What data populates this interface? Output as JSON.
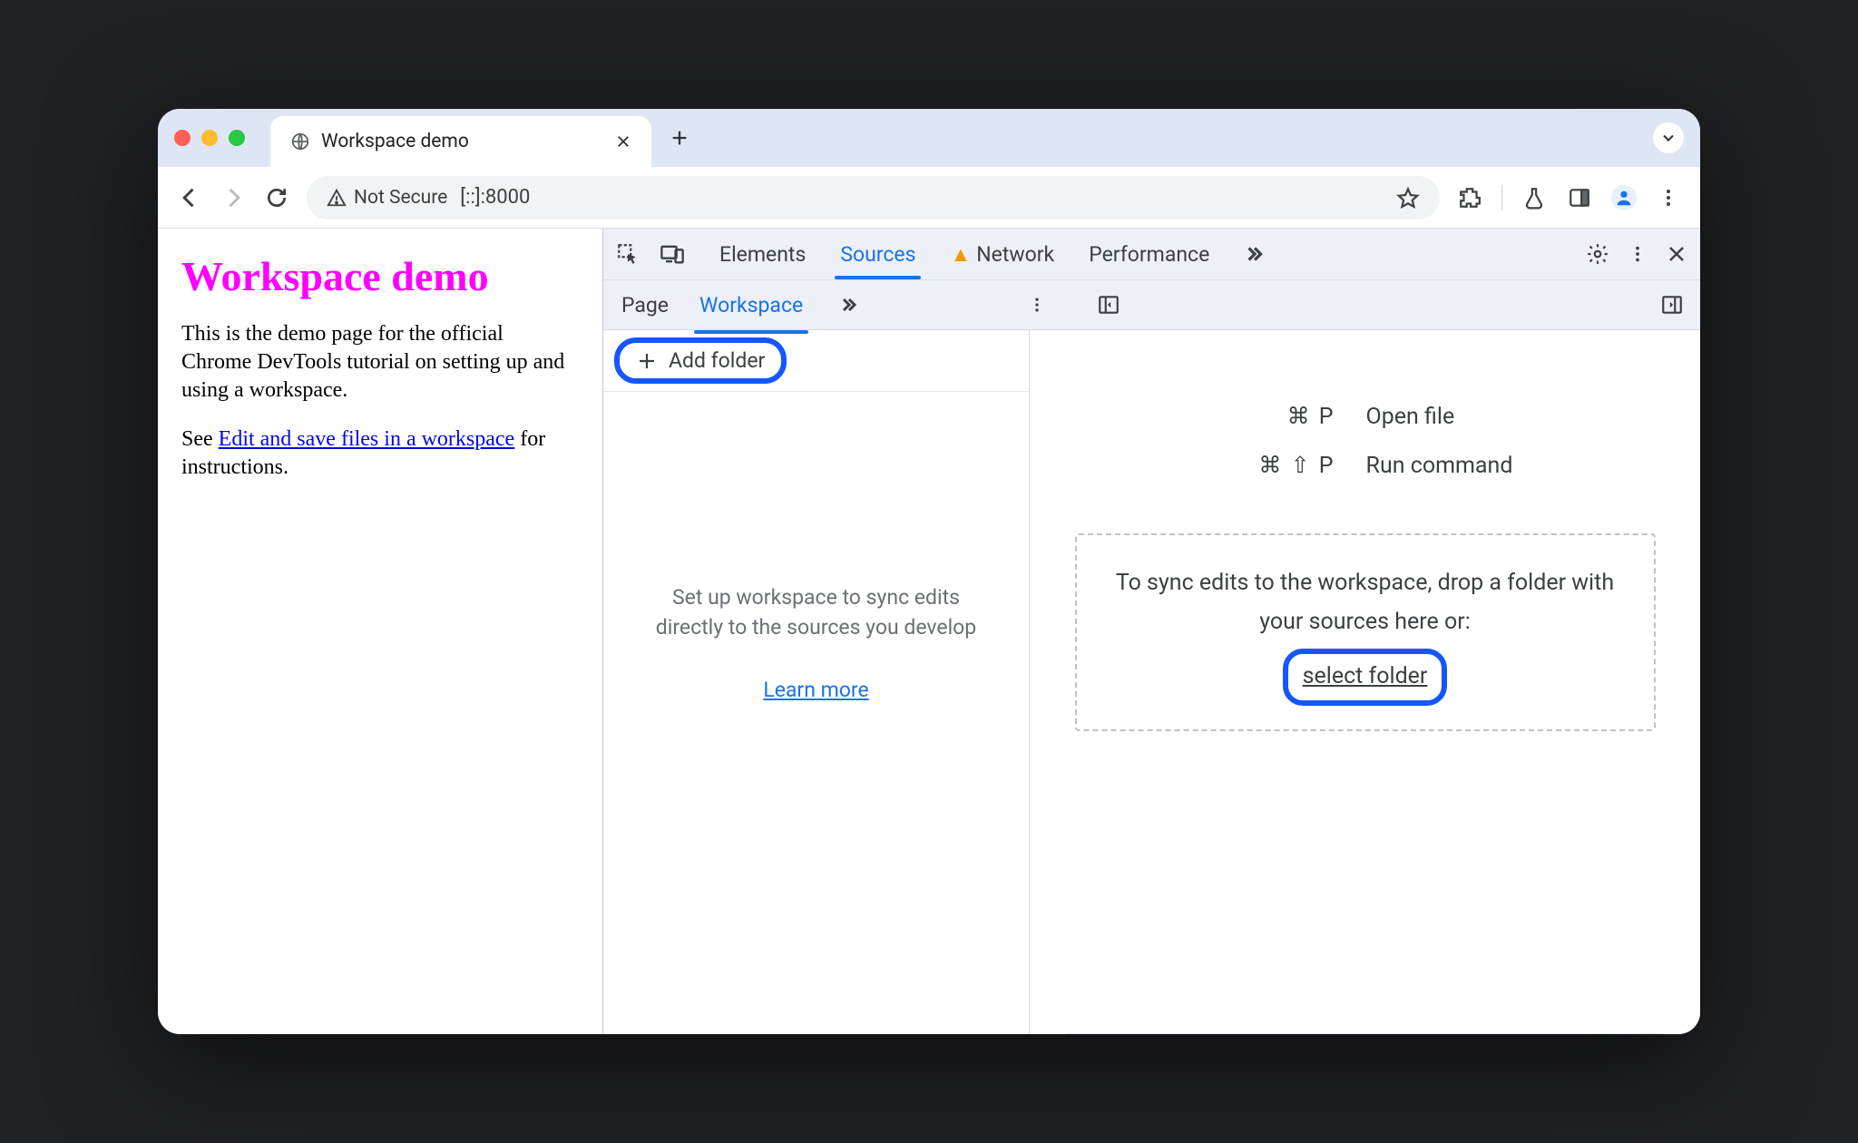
{
  "browser": {
    "tab_title": "Workspace demo",
    "not_secure": "Not Secure",
    "url": "[::]:8000"
  },
  "page": {
    "heading": "Workspace demo",
    "para1": "This is the demo page for the official Chrome DevTools tutorial on setting up and using a workspace.",
    "para2_prefix": "See ",
    "para2_link": "Edit and save files in a workspace",
    "para2_suffix": " for instructions."
  },
  "devtools": {
    "tabs": {
      "elements": "Elements",
      "sources": "Sources",
      "network": "Network",
      "performance": "Performance"
    },
    "subtabs": {
      "page": "Page",
      "workspace": "Workspace"
    },
    "add_folder": "Add folder",
    "nav_hint": "Set up workspace to sync edits directly to the sources you develop",
    "learn_more": "Learn more",
    "shortcut_open_keys": "⌘ P",
    "shortcut_open_label": "Open file",
    "shortcut_run_keys": "⌘ ⇧ P",
    "shortcut_run_label": "Run command",
    "drop_text": "To sync edits to the workspace, drop a folder with your sources here or:",
    "select_folder": "select folder"
  }
}
